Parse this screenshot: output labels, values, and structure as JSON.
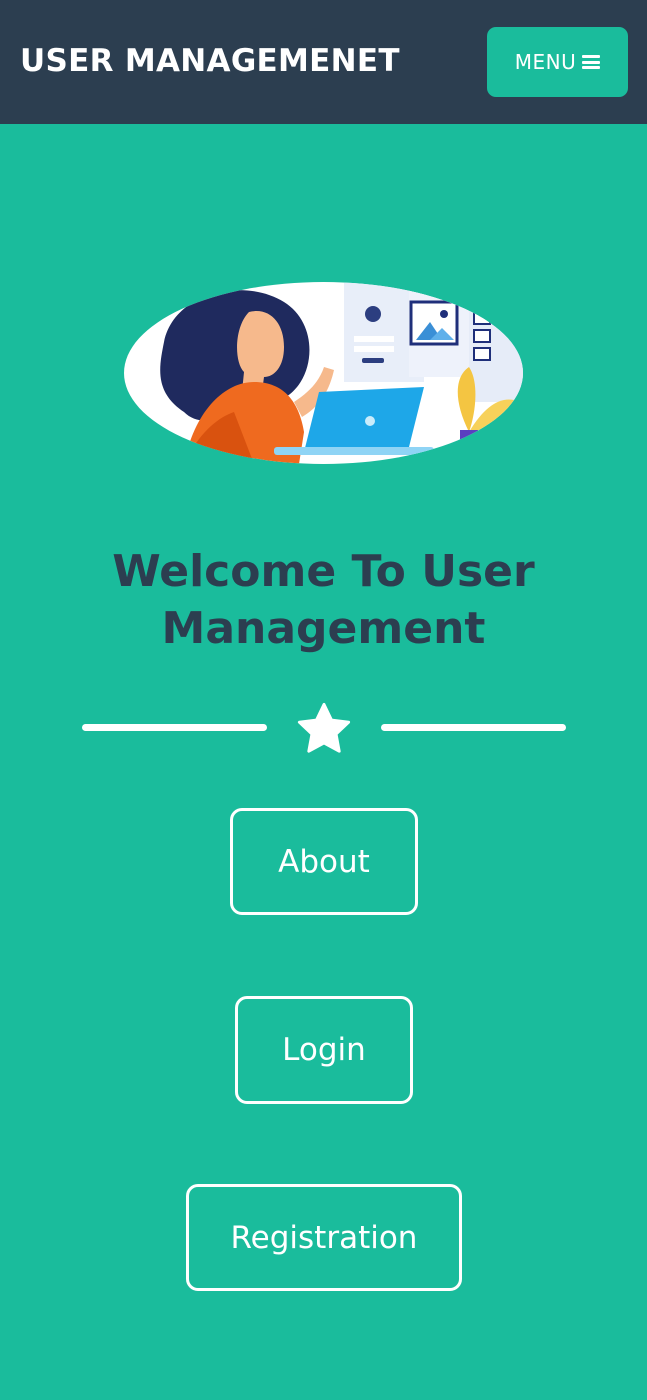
{
  "navbar": {
    "brand": "USER MANAGEMENET",
    "menu_label": "MENU",
    "menu_icon": "bars-icon"
  },
  "hero": {
    "image": "woman-at-laptop-illustration"
  },
  "welcome": {
    "title": "Welcome To User Management"
  },
  "divider": {
    "icon": "star-icon"
  },
  "buttons": {
    "about": "About",
    "login": "Login",
    "registration": "Registration"
  },
  "colors": {
    "background": "#1abc9c",
    "navbar": "#2c3e50",
    "title": "#2c3e50",
    "white": "#ffffff"
  }
}
